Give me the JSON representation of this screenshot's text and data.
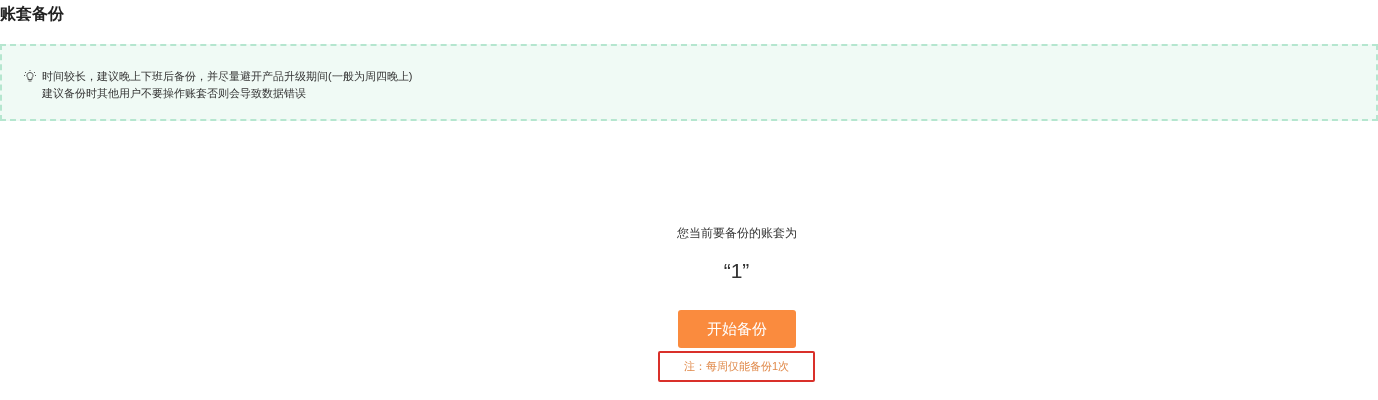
{
  "page_title": "账套备份",
  "tip": {
    "lines": [
      "时间较长，建议晚上下班后备份，并尽量避开产品升级期间(一般为周四晚上)",
      "建议备份时其他用户不要操作账套否则会导致数据错误"
    ]
  },
  "prompt": "您当前要备份的账套为",
  "account_name": "“1”",
  "start_button": "开始备份",
  "note": {
    "text": "注：每周仅能备份1次",
    "highlighted": true
  }
}
